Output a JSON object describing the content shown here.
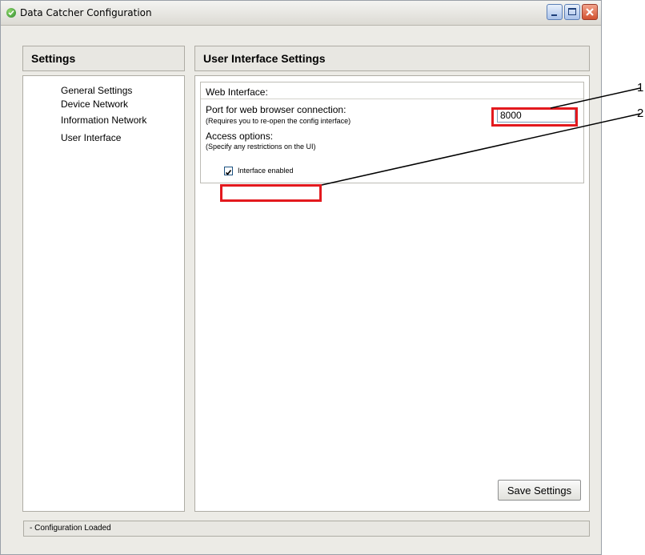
{
  "window": {
    "title": "Data Catcher Configuration"
  },
  "sidebar": {
    "header": "Settings",
    "items": [
      {
        "label": "General Settings"
      },
      {
        "label": "Device Network"
      },
      {
        "label": "Information Network"
      },
      {
        "label": "User Interface"
      }
    ]
  },
  "main": {
    "header": "User Interface Settings",
    "group_title": "Web Interface:",
    "port": {
      "label": "Port for web browser connection:",
      "hint": "(Requires you to re-open the config interface)",
      "value": "8000"
    },
    "access": {
      "label": "Access options:",
      "hint": "(Specify any restrictions on the UI)",
      "checkbox_label": "Interface enabled",
      "checked": true
    },
    "save_label": "Save Settings"
  },
  "status": {
    "text": "- Configuration Loaded"
  },
  "annotations": {
    "callout_1": "1",
    "callout_2": "2",
    "highlight_color": "#e3191e"
  },
  "icons": [
    "app-status-icon",
    "minimize-icon",
    "maximize-icon",
    "close-icon",
    "checkmark-icon"
  ]
}
